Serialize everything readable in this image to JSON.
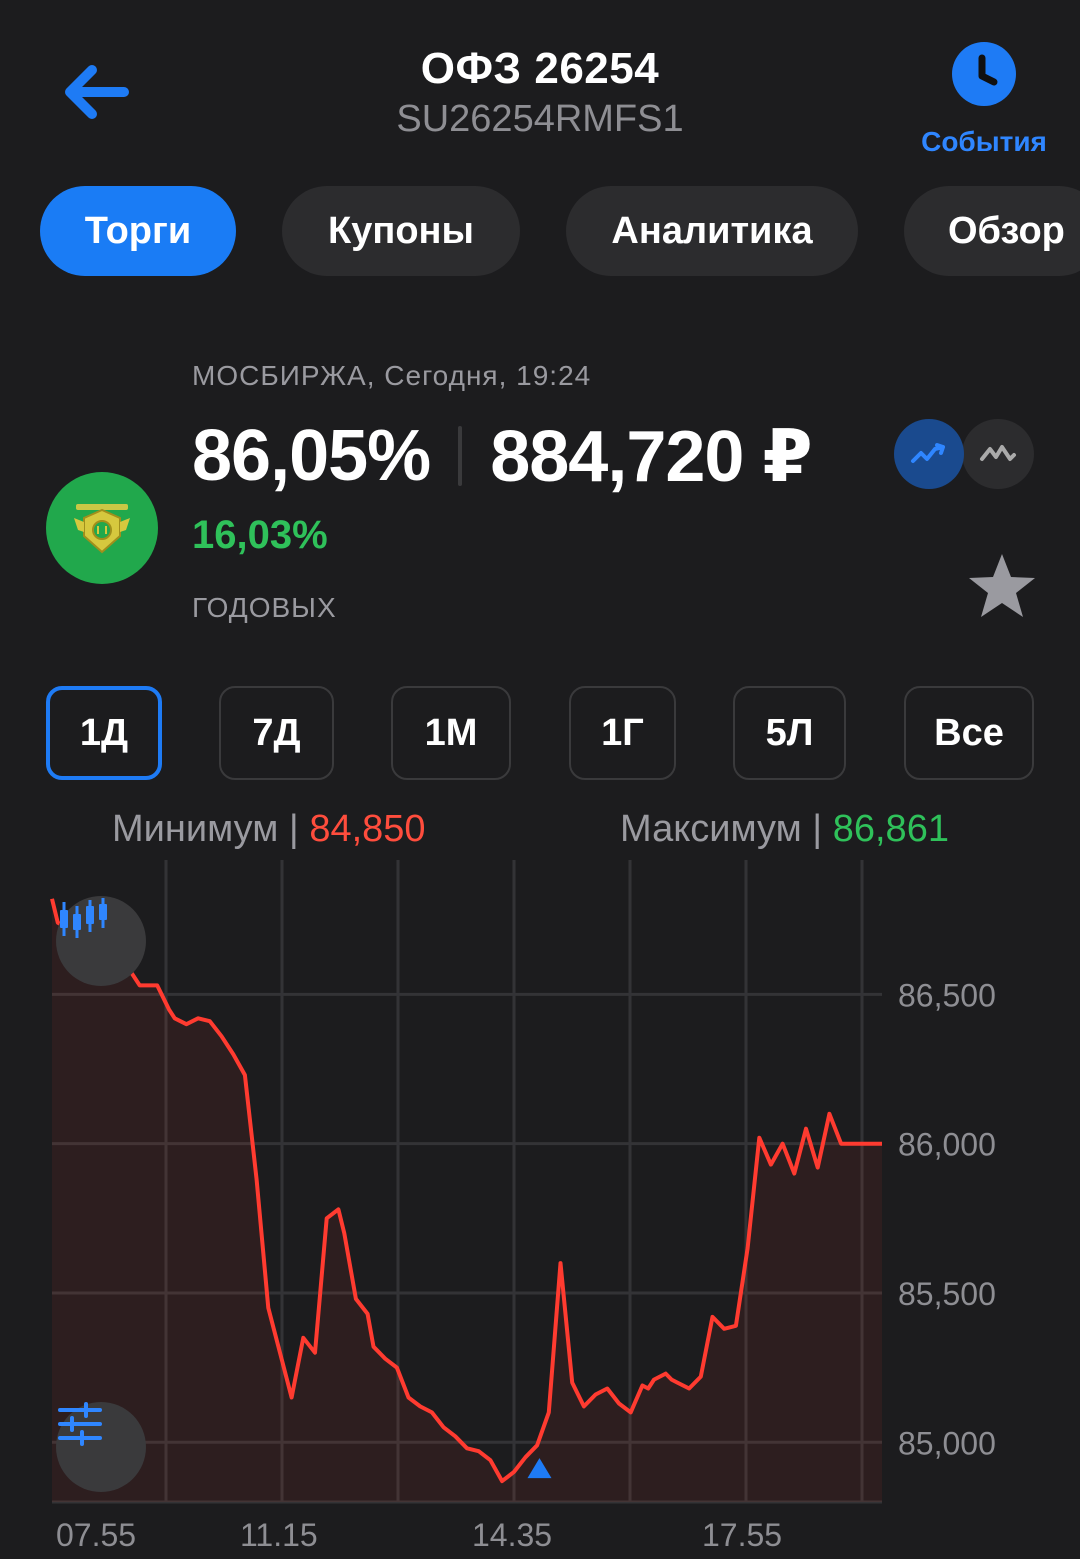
{
  "header": {
    "title": "ОФЗ 26254",
    "subtitle": "SU26254RMFS1",
    "events_label": "События"
  },
  "tabs": [
    {
      "label": "Торги",
      "active": true
    },
    {
      "label": "Купоны",
      "active": false
    },
    {
      "label": "Аналитика",
      "active": false
    },
    {
      "label": "Обзор",
      "active": false
    }
  ],
  "quote": {
    "exchange": "МОСБИРЖА, Сегодня, 19:24",
    "price_pct": "86,05%",
    "price_rub": "884,720 ₽",
    "yield": "16,03%",
    "yield_label": "ГОДОВЫХ"
  },
  "periods": [
    {
      "label": "1Д",
      "active": true
    },
    {
      "label": "7Д",
      "active": false
    },
    {
      "label": "1М",
      "active": false
    },
    {
      "label": "1Г",
      "active": false
    },
    {
      "label": "5Л",
      "active": false
    },
    {
      "label": "Все",
      "active": false
    }
  ],
  "stats": {
    "min_label": "Минимум |",
    "min_value": "84,850",
    "max_label": "Максимум |",
    "max_value": "86,861"
  },
  "colors": {
    "accent": "#1e7bf5",
    "line": "#ff3b30",
    "positive": "#2fc15a",
    "negative": "#ff4d3d"
  },
  "chart_data": {
    "type": "line",
    "x_tick_labels": [
      "07.55",
      "11.15",
      "14.35",
      "17.55"
    ],
    "y_tick_labels": [
      "86,500",
      "86,000",
      "85,500",
      "85,000"
    ],
    "y_ticks": [
      86500,
      86000,
      85500,
      85000
    ],
    "ylim": [
      84800,
      86950
    ],
    "x_range_minutes": [
      455,
      1165
    ],
    "grid": true,
    "series": [
      {
        "x": [
          455,
          460,
          470,
          480,
          490,
          500,
          515,
          530,
          545,
          555,
          560,
          570,
          580,
          590,
          600,
          610,
          620,
          630,
          640,
          650,
          660,
          670,
          680,
          690,
          700,
          705,
          715,
          725,
          730,
          740,
          750,
          760,
          770,
          780,
          790,
          800,
          810,
          820,
          830,
          840,
          850,
          860,
          870,
          880,
          890,
          900,
          910,
          920,
          930,
          940,
          950,
          960,
          965,
          970,
          980,
          985,
          990,
          1000,
          1010,
          1020,
          1030,
          1040,
          1050,
          1060,
          1070,
          1080,
          1090,
          1100,
          1110,
          1120,
          1130,
          1140,
          1145,
          1150,
          1155,
          1160,
          1165
        ],
        "y": [
          86820,
          86740,
          86720,
          86700,
          86690,
          86640,
          86620,
          86530,
          86530,
          86450,
          86420,
          86400,
          86420,
          86410,
          86360,
          86300,
          86230,
          85880,
          85450,
          85300,
          85150,
          85350,
          85300,
          85750,
          85780,
          85700,
          85480,
          85430,
          85320,
          85280,
          85250,
          85150,
          85120,
          85100,
          85050,
          85020,
          84980,
          84970,
          84940,
          84870,
          84900,
          84950,
          84990,
          85100,
          85600,
          85200,
          85120,
          85160,
          85180,
          85130,
          85100,
          85190,
          85180,
          85210,
          85230,
          85210,
          85200,
          85180,
          85220,
          85420,
          85380,
          85390,
          85650,
          86020,
          85930,
          86000,
          85900,
          86050,
          85920,
          86100,
          86000,
          86000,
          86000,
          86000,
          86000,
          86000,
          86000
        ]
      }
    ],
    "marker_min": {
      "x": 872,
      "y": 84900
    }
  }
}
